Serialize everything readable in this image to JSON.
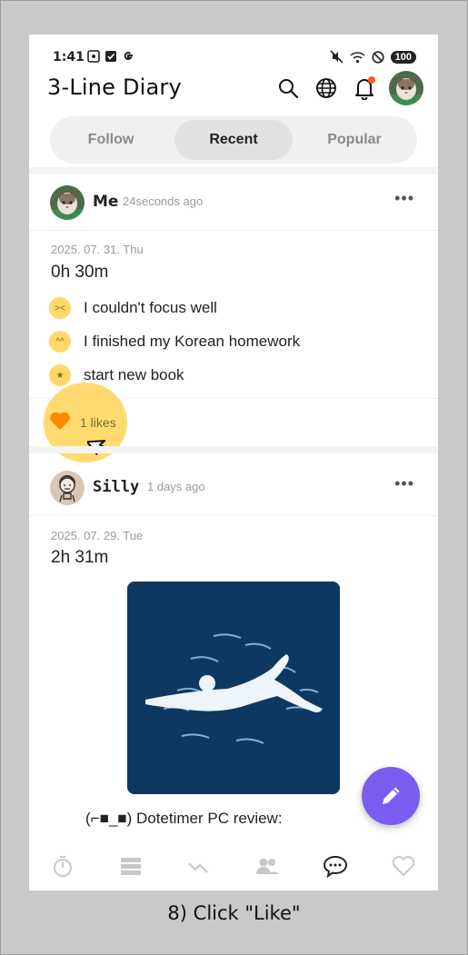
{
  "status_bar": {
    "time": "1:41",
    "left_icons": [
      "screenshot-icon",
      "check-box-icon",
      "google-icon"
    ],
    "right_icons": [
      "mute-icon",
      "wifi-icon",
      "dnd-icon"
    ],
    "battery": "100"
  },
  "app": {
    "title": "3-Line Diary"
  },
  "appbar_icons": [
    "search-icon",
    "globe-icon",
    "bell-icon",
    "profile-avatar"
  ],
  "tabs": [
    {
      "label": "Follow",
      "active": false
    },
    {
      "label": "Recent",
      "active": true
    },
    {
      "label": "Popular",
      "active": false
    }
  ],
  "posts": [
    {
      "author": "Me",
      "time_ago": "24seconds ago",
      "date": "2025. 07. 31. Thu",
      "duration": "0h 30m",
      "lines": [
        {
          "emoji": "confounded-face-icon",
          "text": "I couldn't focus well"
        },
        {
          "emoji": "smiling-face-icon",
          "text": "I finished my Korean homework"
        },
        {
          "emoji": "star-struck-face-icon",
          "text": "start new book"
        }
      ],
      "likes": "1 likes",
      "more": "•••"
    },
    {
      "author": "Silly",
      "time_ago": "1 days ago",
      "date": "2025. 07. 29. Tue",
      "duration": "2h 31m",
      "caption": "(⌐■_■) Dotetimer PC review:",
      "more": "•••"
    }
  ],
  "fab": {
    "icon": "pencil-icon"
  },
  "bottom_nav": [
    "timer-icon",
    "list-icon",
    "stats-icon",
    "friends-icon",
    "chat-icon",
    "heart-icon"
  ],
  "instruction": "8) Click \"Like\"",
  "colors": {
    "accent": "#7b5cf0",
    "like": "#ff8a00",
    "highlight": "#ffd146"
  }
}
